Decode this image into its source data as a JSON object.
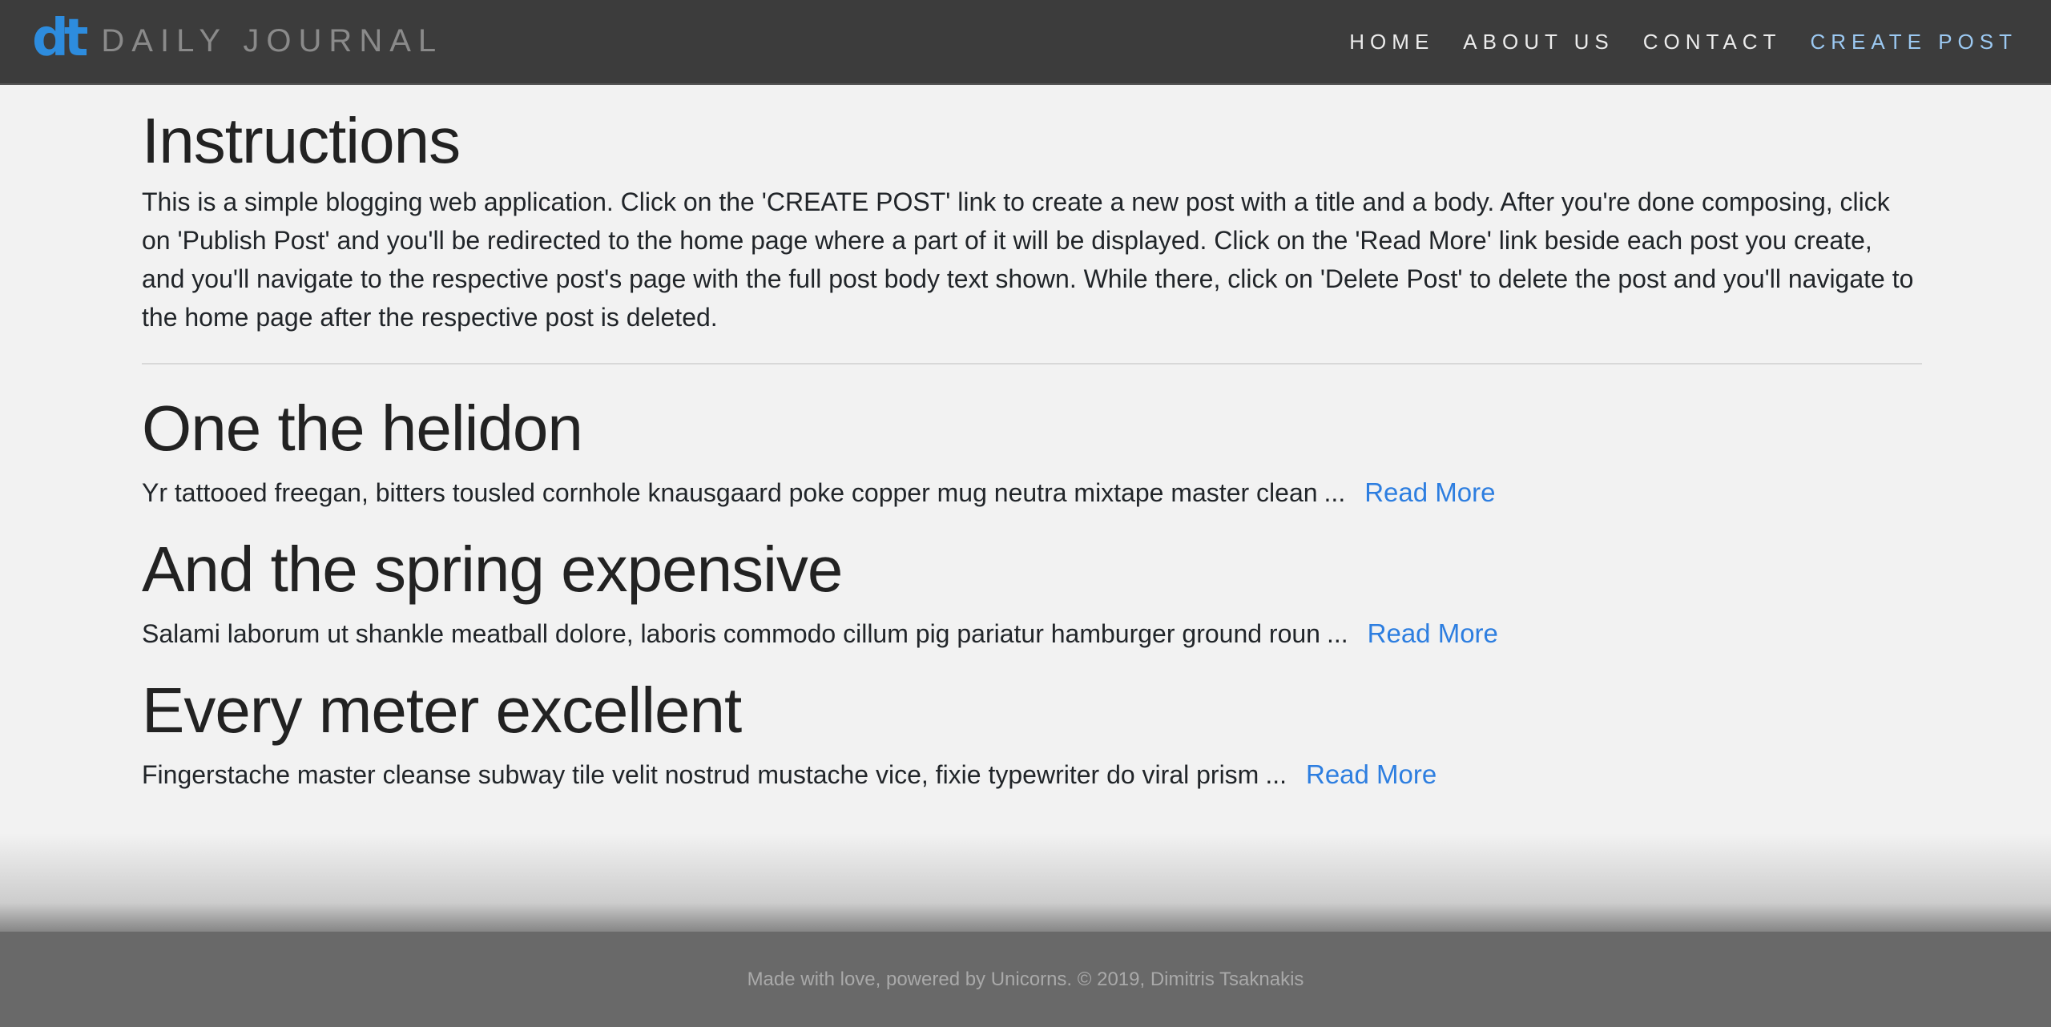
{
  "brand": {
    "logo": "dt",
    "name": "DAILY JOURNAL"
  },
  "nav": {
    "home": "HOME",
    "about": "ABOUT US",
    "contact": "CONTACT",
    "create_post": "CREATE POST"
  },
  "colors": {
    "accent": "#2d7ee0",
    "navbar_bg": "#3c3c3c",
    "footer_bg": "#696969",
    "page_bg": "#f2f2f2"
  },
  "instructions": {
    "title": "Instructions",
    "text": "This is a simple blogging web application. Click on the 'CREATE POST' link to create a new post with a title and a body. After you're done composing, click on 'Publish Post' and you'll be redirected to the home page where a part of it will be displayed. Click on the 'Read More' link beside each post you create, and you'll navigate to the respective post's page with the full post body text shown. While there, click on 'Delete Post' to delete the post and you'll navigate to the home page after the respective post is deleted."
  },
  "posts": [
    {
      "title": "One the helidon",
      "excerpt": "Yr tattooed freegan, bitters tousled cornhole knausgaard poke copper mug neutra mixtape master clean",
      "ellipsis": "...",
      "link": "Read More"
    },
    {
      "title": "And the spring expensive",
      "excerpt": "Salami laborum ut shankle meatball dolore, laboris commodo cillum pig pariatur hamburger ground roun",
      "ellipsis": "...",
      "link": "Read More"
    },
    {
      "title": "Every meter excellent",
      "excerpt": "Fingerstache master cleanse subway tile velit nostrud mustache vice, fixie typewriter do viral prism",
      "ellipsis": "...",
      "link": "Read More"
    }
  ],
  "footer": {
    "text": "Made with love, powered by Unicorns. © 2019, Dimitris Tsaknakis"
  }
}
